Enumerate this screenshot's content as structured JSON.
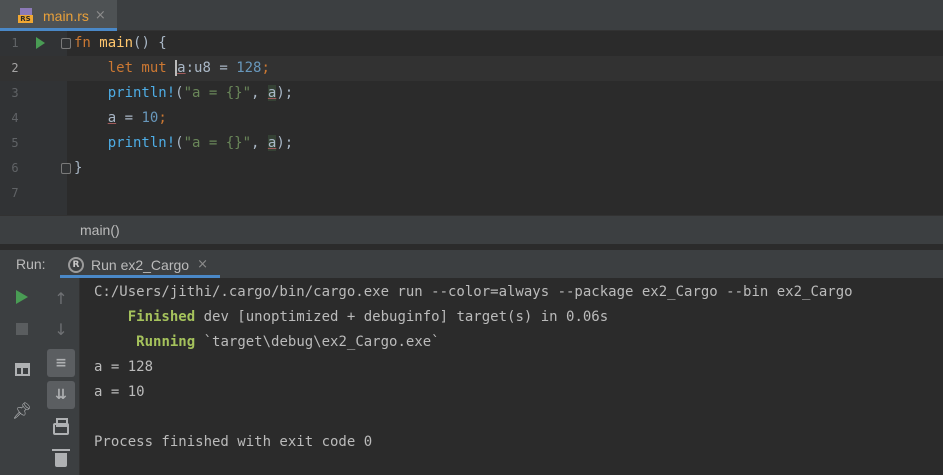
{
  "editor_tab": {
    "label": "main.rs",
    "close": "×",
    "icon_badge": "RS",
    "icon": "rust-file-icon"
  },
  "editor": {
    "lines": [
      {
        "num": "1",
        "code": "fn main() {"
      },
      {
        "num": "2",
        "code": "    let mut a:u8 = 128;"
      },
      {
        "num": "3",
        "code": "    println!(\"a = {}\", a);"
      },
      {
        "num": "4",
        "code": "    a = 10;"
      },
      {
        "num": "5",
        "code": "    println!(\"a = {}\", a);"
      },
      {
        "num": "6",
        "code": "}"
      },
      {
        "num": "7",
        "code": ""
      }
    ],
    "tokens": {
      "fn": "fn",
      "main_name": "main",
      "main_tail": "() {",
      "let_mut": "let mut",
      "a": "a",
      "type_suffix": ":u8 = ",
      "val128": "128",
      "semi": ";",
      "println": "println!",
      "paren_open": "(",
      "fmt_str": "\"a = {}\"",
      "comma": ", ",
      "paren_close": ");",
      "assign": " = ",
      "val10": "10",
      "close_brace": "}"
    }
  },
  "breadcrumb": {
    "label": "main()"
  },
  "run_panel": {
    "title": "Run:",
    "tab_label": "Run ex2_Cargo",
    "tab_close": "×",
    "tab_icon": "cargo-icon",
    "toolbar": {
      "rerun": "play-icon",
      "stop": "stop-icon",
      "layout": "layout-icon",
      "pin": "pin-icon",
      "up": "arrow-up-icon",
      "down": "arrow-down-icon",
      "soft_wrap": "soft-wrap-icon",
      "scroll_end": "scroll-to-end-icon",
      "print": "print-icon",
      "clear": "trash-icon"
    },
    "console": {
      "command": "C:/Users/jithi/.cargo/bin/cargo.exe run --color=always --package ex2_Cargo --bin ex2_Cargo",
      "finished_word": "Finished",
      "finished_rest": " dev [unoptimized + debuginfo] target(s) in 0.06s",
      "running_word": "Running",
      "running_rest": " `target\\debug\\ex2_Cargo.exe`",
      "out1": "a = 128",
      "out2": "a = 10",
      "exit": "Process finished with exit code 0"
    }
  },
  "colors": {
    "keyword": "#cc7832",
    "function": "#ffc66d",
    "number": "#6897bb",
    "macro": "#4eade5",
    "string": "#6a8759",
    "cargo_status": "#a5c25c",
    "accent": "#4a88c7",
    "run_green": "#499c54"
  }
}
